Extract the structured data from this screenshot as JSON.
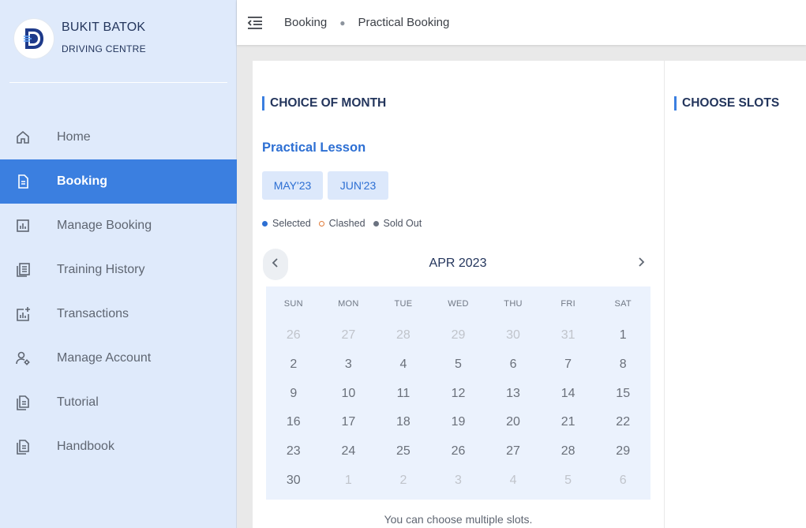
{
  "brand": {
    "name": "BUKIT BATOK",
    "subtitle": "DRIVING CENTRE",
    "logo_color": "#1e3a8a"
  },
  "sidebar": {
    "items": [
      {
        "label": "Home",
        "icon": "home-icon",
        "active": false
      },
      {
        "label": "Booking",
        "icon": "document-icon",
        "active": true
      },
      {
        "label": "Manage Booking",
        "icon": "bar-chart-icon",
        "active": false
      },
      {
        "label": "Training History",
        "icon": "list-icon",
        "active": false
      },
      {
        "label": "Transactions",
        "icon": "chart-plus-icon",
        "active": false
      },
      {
        "label": "Manage Account",
        "icon": "user-settings-icon",
        "active": false
      },
      {
        "label": "Tutorial",
        "icon": "file-icon",
        "active": false
      },
      {
        "label": "Handbook",
        "icon": "file-icon",
        "active": false
      }
    ]
  },
  "breadcrumb": {
    "items": [
      "Booking",
      "Practical Booking"
    ]
  },
  "choice_panel": {
    "title": "CHOICE OF MONTH",
    "lesson_title": "Practical Lesson",
    "months": [
      "MAY'23",
      "JUN'23"
    ],
    "legend": {
      "selected": "Selected",
      "clashed": "Clashed",
      "sold_out": "Sold Out"
    },
    "hint": "You can choose multiple slots."
  },
  "calendar": {
    "title": "APR 2023",
    "weekdays": [
      "SUN",
      "MON",
      "TUE",
      "WED",
      "THU",
      "FRI",
      "SAT"
    ],
    "weeks": [
      [
        {
          "d": "26",
          "m": true
        },
        {
          "d": "27",
          "m": true
        },
        {
          "d": "28",
          "m": true
        },
        {
          "d": "29",
          "m": true
        },
        {
          "d": "30",
          "m": true
        },
        {
          "d": "31",
          "m": true
        },
        {
          "d": "1",
          "m": false
        }
      ],
      [
        {
          "d": "2",
          "m": false
        },
        {
          "d": "3",
          "m": false
        },
        {
          "d": "4",
          "m": false
        },
        {
          "d": "5",
          "m": false
        },
        {
          "d": "6",
          "m": false
        },
        {
          "d": "7",
          "m": false
        },
        {
          "d": "8",
          "m": false
        }
      ],
      [
        {
          "d": "9",
          "m": false
        },
        {
          "d": "10",
          "m": false
        },
        {
          "d": "11",
          "m": false
        },
        {
          "d": "12",
          "m": false
        },
        {
          "d": "13",
          "m": false
        },
        {
          "d": "14",
          "m": false
        },
        {
          "d": "15",
          "m": false
        }
      ],
      [
        {
          "d": "16",
          "m": false
        },
        {
          "d": "17",
          "m": false
        },
        {
          "d": "18",
          "m": false
        },
        {
          "d": "19",
          "m": false
        },
        {
          "d": "20",
          "m": false
        },
        {
          "d": "21",
          "m": false
        },
        {
          "d": "22",
          "m": false
        }
      ],
      [
        {
          "d": "23",
          "m": false
        },
        {
          "d": "24",
          "m": false
        },
        {
          "d": "25",
          "m": false
        },
        {
          "d": "26",
          "m": false
        },
        {
          "d": "27",
          "m": false
        },
        {
          "d": "28",
          "m": false
        },
        {
          "d": "29",
          "m": false
        }
      ],
      [
        {
          "d": "30",
          "m": false
        },
        {
          "d": "1",
          "m": true
        },
        {
          "d": "2",
          "m": true
        },
        {
          "d": "3",
          "m": true
        },
        {
          "d": "4",
          "m": true
        },
        {
          "d": "5",
          "m": true
        },
        {
          "d": "6",
          "m": true
        }
      ]
    ]
  },
  "slots_panel": {
    "title": "CHOOSE SLOTS"
  },
  "colors": {
    "accent": "#3b7fe0",
    "sidebar_bg": "#dfeafb",
    "calendar_bg": "#ebf2fd"
  }
}
